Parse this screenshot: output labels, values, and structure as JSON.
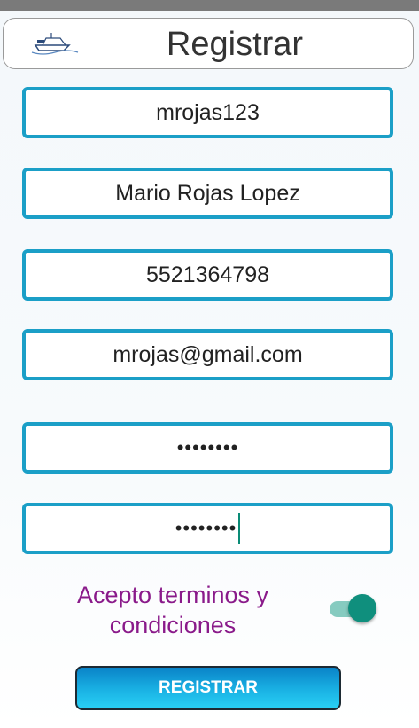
{
  "header": {
    "title": "Registrar",
    "logo_icon": "ship-logo-icon"
  },
  "form": {
    "username": "mrojas123",
    "full_name": "Mario Rojas Lopez",
    "phone": "5521364798",
    "email": "mrojas@gmail.com",
    "password": "••••••••",
    "confirm_password": "••••••••"
  },
  "terms": {
    "label": "Acepto terminos y condiciones",
    "toggle_on": true
  },
  "register_button": {
    "label": "REGISTRAR"
  },
  "colors": {
    "field_border": "#1b9fc7",
    "terms_text": "#8a1a8a",
    "toggle_on": "#0f8f7d",
    "button": "#1ab2e4"
  }
}
